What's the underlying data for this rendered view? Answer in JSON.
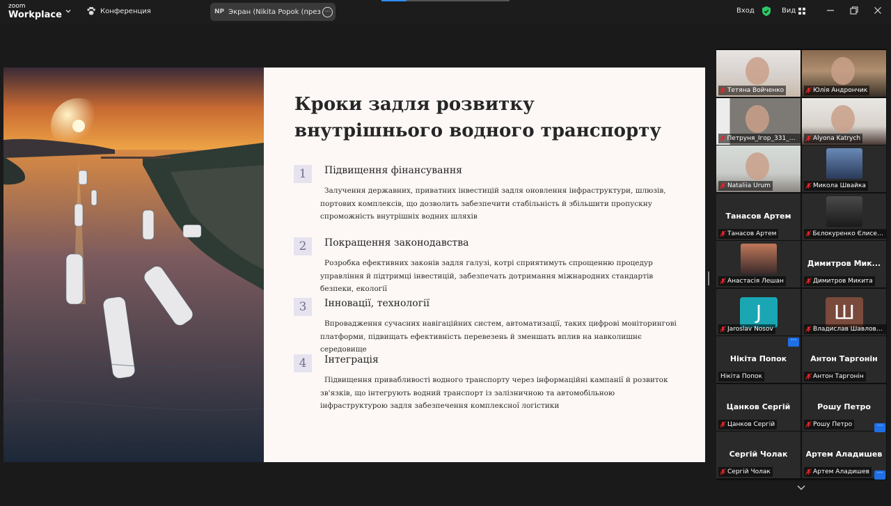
{
  "app": {
    "brand_line1": "zoom",
    "brand_line2": "Workplace",
    "meeting_label": "Конференция"
  },
  "share_pill": {
    "initials": "NP",
    "text": "Экран (Nikita Popok (презентац"
  },
  "controls": {
    "login": "Вход",
    "view": "Вид"
  },
  "slide": {
    "title": "Кроки задля розвитку внутрішнього водного транспорту",
    "items": [
      {
        "num": "1",
        "heading": "Підвищення фінансування",
        "body": "Залучення державних, приватних інвестицій задля оновлення інфраструктури, шлюзів, портових комплексів, що дозволить забезпечити стабільність й збільшити пропускну спроможність внутрішніх водних шляхів"
      },
      {
        "num": "2",
        "heading": "Покращення законодавства",
        "body": "Розробка ефективних законів задля галузі, котрі сприятимуть спрощенню процедур управління й підтримці інвестицій, забезпечать дотримання міжнародних стандартів безпеки, екології"
      },
      {
        "num": "3",
        "heading": "Інновації, технології",
        "body": "Впровадження сучасних навігаційних систем, автоматизації, таких цифрові моніторингові платформи, підвищать ефективність перевезень й зменшать вплив на навколишнє середовище"
      },
      {
        "num": "4",
        "heading": "Інтеграція",
        "body": "Підвищення привабливості водного транспорту через інформаційні кампанії й розвиток зв'язків, що інтегрують водний транспорт із залізничною та автомобільною інфраструктурою задля забезпечення комплексної логістики"
      }
    ]
  },
  "participants": [
    {
      "name": "Тетяна Войченко",
      "big": "",
      "avatar": "",
      "muted": true,
      "kind": "video-a"
    },
    {
      "name": "Юлія Андрончик",
      "big": "",
      "avatar": "",
      "muted": true,
      "kind": "video-b"
    },
    {
      "name": "Петруня_Ігор_331_УС...",
      "big": "",
      "avatar": "",
      "muted": true,
      "kind": "video-c"
    },
    {
      "name": "Alyona Katrych",
      "big": "",
      "avatar": "",
      "muted": true,
      "kind": "video-d"
    },
    {
      "name": "Nataliia Urum",
      "big": "",
      "avatar": "",
      "muted": true,
      "kind": "video-e"
    },
    {
      "name": "Микола Швайка",
      "big": "",
      "avatar": "",
      "muted": true,
      "kind": "photo-f"
    },
    {
      "name": "Танасов Артем",
      "big": "Танасов Артем",
      "avatar": "",
      "muted": true,
      "kind": "plain"
    },
    {
      "name": "Бєлокуренко Єлисей ...",
      "big": "",
      "avatar": "",
      "muted": true,
      "kind": "photo-g"
    },
    {
      "name": "Анастасія Лешан",
      "big": "",
      "avatar": "",
      "muted": true,
      "kind": "photo-h"
    },
    {
      "name": "Димитров Микита",
      "big": "Димитров Мик...",
      "avatar": "",
      "muted": true,
      "kind": "plain"
    },
    {
      "name": "Jaroslav Nosov",
      "big": "",
      "avatar": "J",
      "muted": true,
      "kind": "avatar-j"
    },
    {
      "name": "Владислав Шавловс...",
      "big": "",
      "avatar": "Ш",
      "muted": true,
      "kind": "avatar-sh"
    },
    {
      "name": "Нікіта Попок",
      "big": "Нікіта Попок",
      "avatar": "",
      "muted": false,
      "kind": "plain",
      "active": true
    },
    {
      "name": "Антон Таргонін",
      "big": "Антон Таргонін",
      "avatar": "",
      "muted": true,
      "kind": "plain"
    },
    {
      "name": "Цанков Сергій",
      "big": "Цанков Сергій",
      "avatar": "",
      "muted": true,
      "kind": "plain"
    },
    {
      "name": "Рошу Петро",
      "big": "Рошу Петро",
      "avatar": "",
      "muted": true,
      "kind": "plain"
    },
    {
      "name": "Сергій Чолак",
      "big": "Сергій Чолак",
      "avatar": "",
      "muted": true,
      "kind": "plain"
    },
    {
      "name": "Артем Аладишев",
      "big": "Артем Аладишев",
      "avatar": "",
      "muted": true,
      "kind": "plain"
    }
  ],
  "more_symbol": "···",
  "colors": {
    "active_border": "#3ad17a",
    "more_button": "#1f6fe5",
    "mute_red": "#e02828",
    "avatar_j": "#1aa7b3",
    "avatar_sh": "#7a4a3c",
    "shield": "#2ec866"
  }
}
